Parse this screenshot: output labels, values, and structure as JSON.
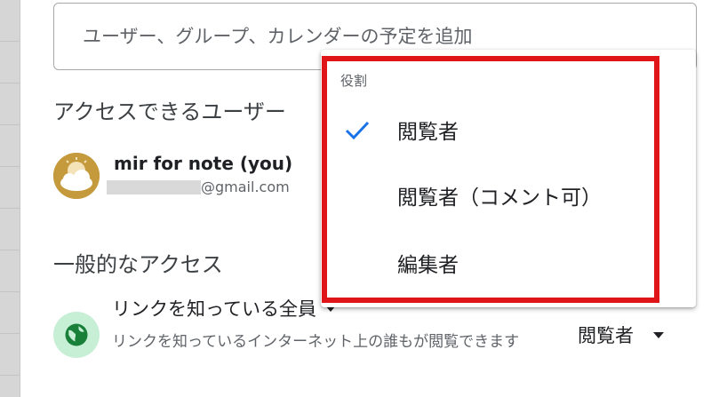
{
  "share": {
    "add_placeholder": "ユーザー、グループ、カレンダーの予定を追加"
  },
  "people": {
    "section_title": "アクセスできるユーザー",
    "users": [
      {
        "name": "mir for note (you)",
        "email_suffix": "@gmail.com"
      }
    ]
  },
  "general_access": {
    "section_title": "一般的なアクセス",
    "link_setting": "リンクを知っている全員",
    "description": "リンクを知っているインターネット上の誰もが閲覧できます",
    "role": "閲覧者"
  },
  "role_menu": {
    "header": "役割",
    "items": [
      {
        "label": "閲覧者",
        "selected": true
      },
      {
        "label": "閲覧者（コメント可）",
        "selected": false
      },
      {
        "label": "編集者",
        "selected": false
      }
    ]
  },
  "colors": {
    "highlight": "#e0151a",
    "check": "#1a73e8",
    "globe_bg": "#c6efd6",
    "globe_fg": "#188038"
  }
}
